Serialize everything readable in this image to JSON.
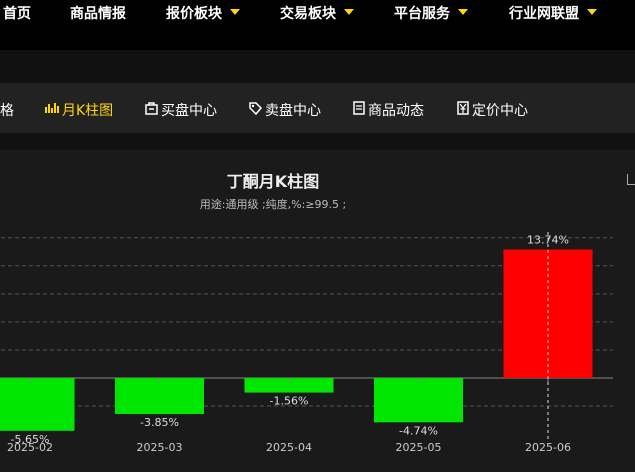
{
  "topnav": {
    "items": [
      {
        "label": "首页",
        "dropdown": false
      },
      {
        "label": "商品情报",
        "dropdown": false
      },
      {
        "label": "报价板块",
        "dropdown": true
      },
      {
        "label": "交易板块",
        "dropdown": true
      },
      {
        "label": "平台服务",
        "dropdown": true
      },
      {
        "label": "行业网联盟",
        "dropdown": true
      }
    ]
  },
  "subnav": {
    "items": [
      {
        "label": "格",
        "icon": "",
        "active": false
      },
      {
        "label": "月K柱图",
        "icon": "bar-chart-icon",
        "active": true
      },
      {
        "label": "买盘中心",
        "icon": "buy-box-icon",
        "active": false
      },
      {
        "label": "卖盘中心",
        "icon": "tag-icon",
        "active": false
      },
      {
        "label": "商品动态",
        "icon": "document-icon",
        "active": false
      },
      {
        "label": "定价中心",
        "icon": "yen-icon",
        "active": false
      }
    ]
  },
  "chart": {
    "title": "丁酮月K柱图",
    "subtitle": "用途:通用级 ;纯度,%:≥99.5 ;"
  },
  "colors": {
    "positive": "#ff0000",
    "negative": "#00e600",
    "active_nav": "#ffd800"
  },
  "chart_data": {
    "type": "bar",
    "title": "丁酮月K柱图",
    "categories": [
      "2025-02",
      "2025-03",
      "2025-04",
      "2025-05",
      "2025-06"
    ],
    "values": [
      -5.65,
      -3.85,
      -1.56,
      -4.74,
      13.74
    ],
    "value_labels": [
      "-5.65%",
      "-3.85%",
      "-1.56%",
      "-4.74%",
      "13.74%"
    ],
    "ylim": [
      -6.5,
      15
    ],
    "grid": true,
    "highlight_category": "2025-06"
  }
}
